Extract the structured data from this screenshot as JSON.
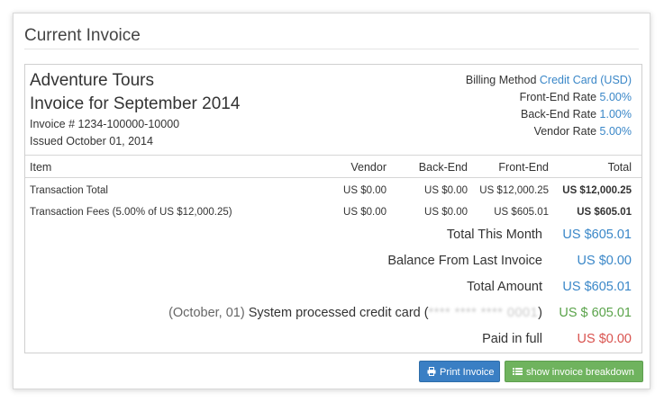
{
  "panel": {
    "title": "Current Invoice"
  },
  "invoice": {
    "company": "Adventure Tours",
    "title": "Invoice for September 2014",
    "number": "Invoice # 1234-100000-10000",
    "issued": "Issued October 01, 2014"
  },
  "rates": {
    "billing_method_label": "Billing Method",
    "billing_method_value": "Credit Card (USD)",
    "front_end_label": "Front-End Rate",
    "front_end_value": "5.00%",
    "back_end_label": "Back-End Rate",
    "back_end_value": "1.00%",
    "vendor_label": "Vendor Rate",
    "vendor_value": "5.00%"
  },
  "table": {
    "headers": {
      "item": "Item",
      "vendor": "Vendor",
      "back_end": "Back-End",
      "front_end": "Front-End",
      "total": "Total"
    },
    "rows": [
      {
        "item": "Transaction Total",
        "vendor": "US $0.00",
        "back_end": "US $0.00",
        "front_end": "US $12,000.25",
        "total": "US $12,000.25"
      },
      {
        "item": "Transaction Fees (5.00% of US $12,000.25)",
        "vendor": "US $0.00",
        "back_end": "US $0.00",
        "front_end": "US $605.01",
        "total": "US $605.01"
      }
    ]
  },
  "summary": {
    "total_this_month_label": "Total This Month",
    "total_this_month_value": "US $605.01",
    "balance_label": "Balance From Last Invoice",
    "balance_value": "US $0.00",
    "total_amount_label": "Total Amount",
    "total_amount_value": "US $605.01",
    "processed_prefix": "(October, 01)",
    "processed_label": "System processed credit card (",
    "processed_card_masked": "**** **** **** 0001",
    "processed_suffix": ")",
    "processed_value": "US $ 605.01",
    "paid_label": "Paid in full",
    "paid_value": "US $0.00"
  },
  "buttons": {
    "print": "Print Invoice",
    "breakdown": "show invoice breakdown"
  },
  "colors": {
    "link_blue": "#3a87c8",
    "success_green": "#5aa34a",
    "danger_red": "#d9534f"
  }
}
